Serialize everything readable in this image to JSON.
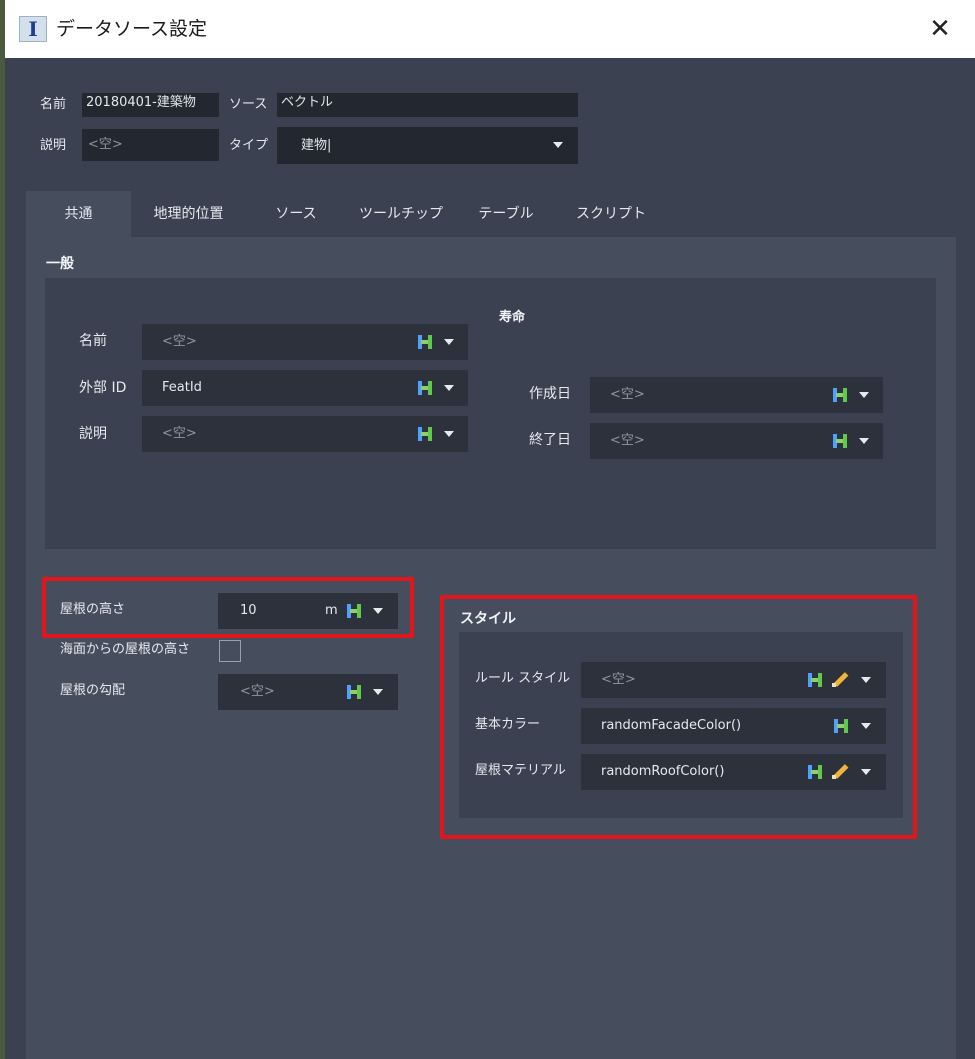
{
  "window": {
    "title": "データソース設定",
    "app_icon_letter": "I"
  },
  "header": {
    "name_label": "名前",
    "name_value": "20180401-建築物",
    "source_label": "ソース",
    "source_value": "ベクトル",
    "desc_label": "説明",
    "desc_placeholder": "<空>",
    "type_label": "タイプ",
    "type_value": "建物|"
  },
  "tabs": [
    {
      "label": "共通",
      "active": true
    },
    {
      "label": "地理的位置",
      "active": false
    },
    {
      "label": "ソース",
      "active": false
    },
    {
      "label": "ツールチップ",
      "active": false
    },
    {
      "label": "テーブル",
      "active": false
    },
    {
      "label": "スクリプト",
      "active": false
    }
  ],
  "general": {
    "title": "一般",
    "lifespan_title": "寿命",
    "name_label": "名前",
    "name_value": "<空>",
    "external_id_label": "外部 ID",
    "external_id_value": "FeatId",
    "desc_label": "説明",
    "desc_value": "<空>",
    "created_label": "作成日",
    "created_value": "<空>",
    "end_label": "終了日",
    "end_value": "<空>"
  },
  "roof": {
    "height_label": "屋根の高さ",
    "height_value": "10",
    "height_unit": "m",
    "sea_level_label": "海面からの屋根の高さ",
    "slope_label": "屋根の勾配",
    "slope_value": "<空>"
  },
  "style": {
    "title": "スタイル",
    "rule_label": "ルール スタイル",
    "rule_value": "<空>",
    "base_color_label": "基本カラー",
    "base_color_value": "randomFacadeColor()",
    "roof_material_label": "屋根マテリアル",
    "roof_material_value": "randomRoofColor()"
  },
  "colors": {
    "highlight": "#e0161b",
    "panel": "#464d5d",
    "background": "#3b4150"
  }
}
